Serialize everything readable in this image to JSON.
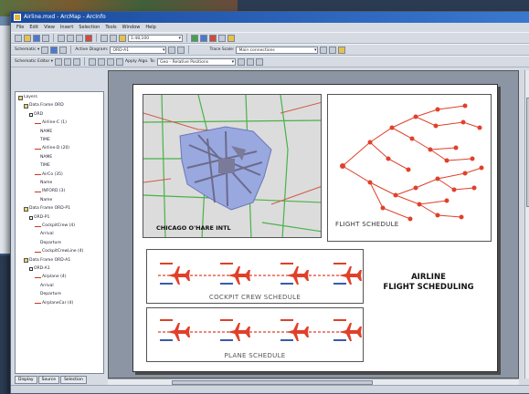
{
  "window": {
    "title": "Airline.mxd - ArcMap - ArcInfo"
  },
  "menu": [
    "File",
    "Edit",
    "View",
    "Insert",
    "Selection",
    "Tools",
    "Window",
    "Help"
  ],
  "toolbar1": {
    "scale": "1:48,100"
  },
  "toolbar2": {
    "schematic_label": "Schematic ▾",
    "diagram_label": "Active Diagram:",
    "diagram_value": "ORD-A1",
    "trace_label": "Trace Scale:",
    "trace_value": "Main connections"
  },
  "toolbar3": {
    "editor_label": "Schematic Editor ▾",
    "algo_label": "Apply Algo. To:",
    "algo_value": "Geo - Relative Positions"
  },
  "toc": {
    "items": [
      {
        "label": "Layers",
        "indent": 0,
        "kind": "folder"
      },
      {
        "label": "Data Frame ORD",
        "indent": 1,
        "kind": "folder"
      },
      {
        "label": "ORD",
        "indent": 2,
        "kind": "check"
      },
      {
        "label": "Airline-C (1)",
        "indent": 3,
        "kind": "line"
      },
      {
        "label": "NAME",
        "indent": 4,
        "kind": "text"
      },
      {
        "label": "TIME",
        "indent": 4,
        "kind": "text"
      },
      {
        "label": "Airline-D (20)",
        "indent": 3,
        "kind": "line"
      },
      {
        "label": "NAME",
        "indent": 4,
        "kind": "text"
      },
      {
        "label": "TIME",
        "indent": 4,
        "kind": "text"
      },
      {
        "label": "AirCo (35)",
        "indent": 3,
        "kind": "line"
      },
      {
        "label": "Name",
        "indent": 4,
        "kind": "text"
      },
      {
        "label": "INFORD (3)",
        "indent": 3,
        "kind": "line"
      },
      {
        "label": "Name",
        "indent": 4,
        "kind": "text"
      },
      {
        "label": "Data Frame ORD-P1",
        "indent": 1,
        "kind": "folder"
      },
      {
        "label": "ORD-P1",
        "indent": 2,
        "kind": "check"
      },
      {
        "label": "CockpitCrew (4)",
        "indent": 3,
        "kind": "line"
      },
      {
        "label": "Arrival",
        "indent": 4,
        "kind": "text"
      },
      {
        "label": "Departure",
        "indent": 4,
        "kind": "text"
      },
      {
        "label": "CockpitCrewLine (4)",
        "indent": 3,
        "kind": "line"
      },
      {
        "label": "Data Frame ORD-A1",
        "indent": 1,
        "kind": "folder"
      },
      {
        "label": "ORD-A1",
        "indent": 2,
        "kind": "check"
      },
      {
        "label": "Airplane (4)",
        "indent": 3,
        "kind": "line"
      },
      {
        "label": "Arrival",
        "indent": 4,
        "kind": "text"
      },
      {
        "label": "Departure",
        "indent": 4,
        "kind": "text"
      },
      {
        "label": "AirplaneCar (4)",
        "indent": 3,
        "kind": "line"
      }
    ],
    "tabs": [
      "Display",
      "Source",
      "Selection"
    ]
  },
  "layout": {
    "map_label": "CHICAGO O'HARE INTL",
    "flight_label": "FLIGHT SCHEDULE",
    "cockpit_label": "COCKPIT CREW SCHEDULE",
    "plane_label": "PLANE SCHEDULE",
    "title_line1": "AIRLINE",
    "title_line2": "FLIGHT SCHEDULING"
  },
  "colors": {
    "schedule_red": "#e0402a",
    "map_blue": "#9aa8e0",
    "road_green": "#49b249",
    "road_red": "#d05a4a"
  }
}
